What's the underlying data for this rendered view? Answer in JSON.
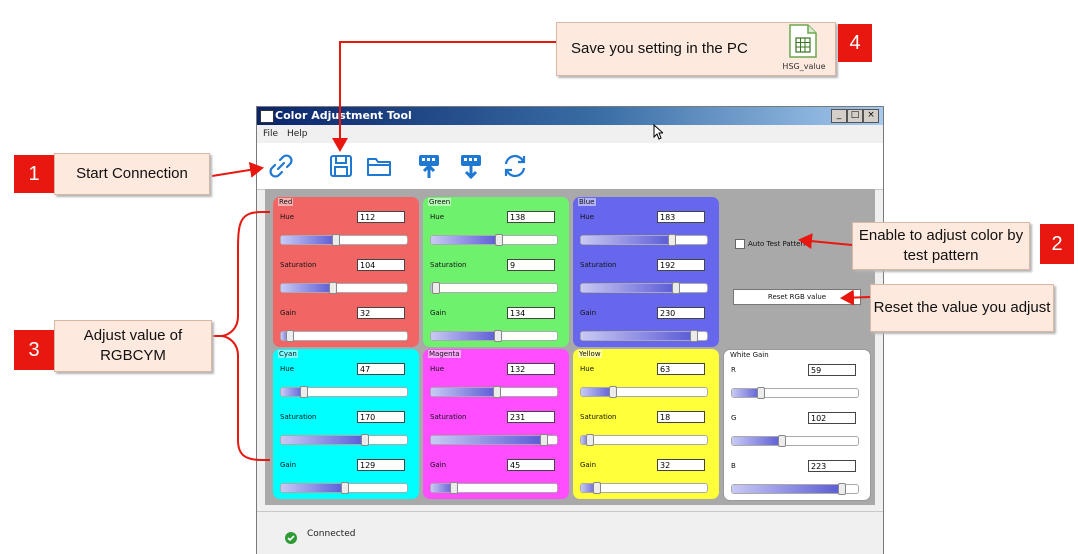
{
  "window": {
    "title": "Color Adjustment Tool",
    "min": "_",
    "max": "□",
    "close": "×"
  },
  "menu": [
    "File",
    "Help"
  ],
  "callouts": {
    "c1": {
      "num": "1",
      "text": "Start Connection"
    },
    "c2": {
      "num": "2",
      "text": "Enable to adjust color by test pattern"
    },
    "c3": {
      "num": "3",
      "text": "Adjust value of RGBCYM"
    },
    "c4": {
      "num": "4",
      "text": "Save you setting in the PC",
      "file_label": "HSG_value"
    },
    "reset": {
      "text": "Reset the value you adjust"
    }
  },
  "groups": [
    {
      "key": "red",
      "title": "Red",
      "color": "#f26565",
      "rows": [
        {
          "label": "Hue",
          "value": "112",
          "level": 0.44
        },
        {
          "label": "Saturation",
          "value": "104",
          "level": 0.41
        },
        {
          "label": "Gain",
          "value": "32",
          "level": 0.07
        }
      ]
    },
    {
      "key": "green",
      "title": "Green",
      "color": "#6ef26e",
      "rows": [
        {
          "label": "Hue",
          "value": "138",
          "level": 0.54
        },
        {
          "label": "Saturation",
          "value": "9",
          "level": 0.04
        },
        {
          "label": "Gain",
          "value": "134",
          "level": 0.53
        }
      ]
    },
    {
      "key": "blue",
      "title": "Blue",
      "color": "#6767ee",
      "rows": [
        {
          "label": "Hue",
          "value": "183",
          "level": 0.72
        },
        {
          "label": "Saturation",
          "value": "192",
          "level": 0.75
        },
        {
          "label": "Gain",
          "value": "230",
          "level": 0.9
        }
      ]
    },
    {
      "key": "cyan",
      "title": "Cyan",
      "color": "#00ffff",
      "rows": [
        {
          "label": "Hue",
          "value": "47",
          "level": 0.18
        },
        {
          "label": "Saturation",
          "value": "170",
          "level": 0.67
        },
        {
          "label": "Gain",
          "value": "129",
          "level": 0.51
        }
      ]
    },
    {
      "key": "magenta",
      "title": "Magenta",
      "color": "#ff4dff",
      "rows": [
        {
          "label": "Hue",
          "value": "132",
          "level": 0.52
        },
        {
          "label": "Saturation",
          "value": "231",
          "level": 0.9
        },
        {
          "label": "Gain",
          "value": "45",
          "level": 0.18
        }
      ]
    },
    {
      "key": "yellow",
      "title": "Yellow",
      "color": "#ffff3a",
      "rows": [
        {
          "label": "Hue",
          "value": "63",
          "level": 0.25
        },
        {
          "label": "Saturation",
          "value": "18",
          "level": 0.07
        },
        {
          "label": "Gain",
          "value": "32",
          "level": 0.13
        }
      ]
    },
    {
      "key": "white",
      "title": "White Gain",
      "color": "#ffffff",
      "rows": [
        {
          "label": "R",
          "value": "59",
          "level": 0.23
        },
        {
          "label": "G",
          "value": "102",
          "level": 0.4
        },
        {
          "label": "B",
          "value": "223",
          "level": 0.87
        }
      ]
    }
  ],
  "controls": {
    "test_pattern_label": "Auto Test Pattern",
    "reset_button": "Reset RGB value"
  },
  "status": {
    "text": "Connected"
  },
  "toolbar_icons": [
    "link-icon",
    "save-icon",
    "folder-icon",
    "upload-icon",
    "download-icon",
    "refresh-icon"
  ]
}
